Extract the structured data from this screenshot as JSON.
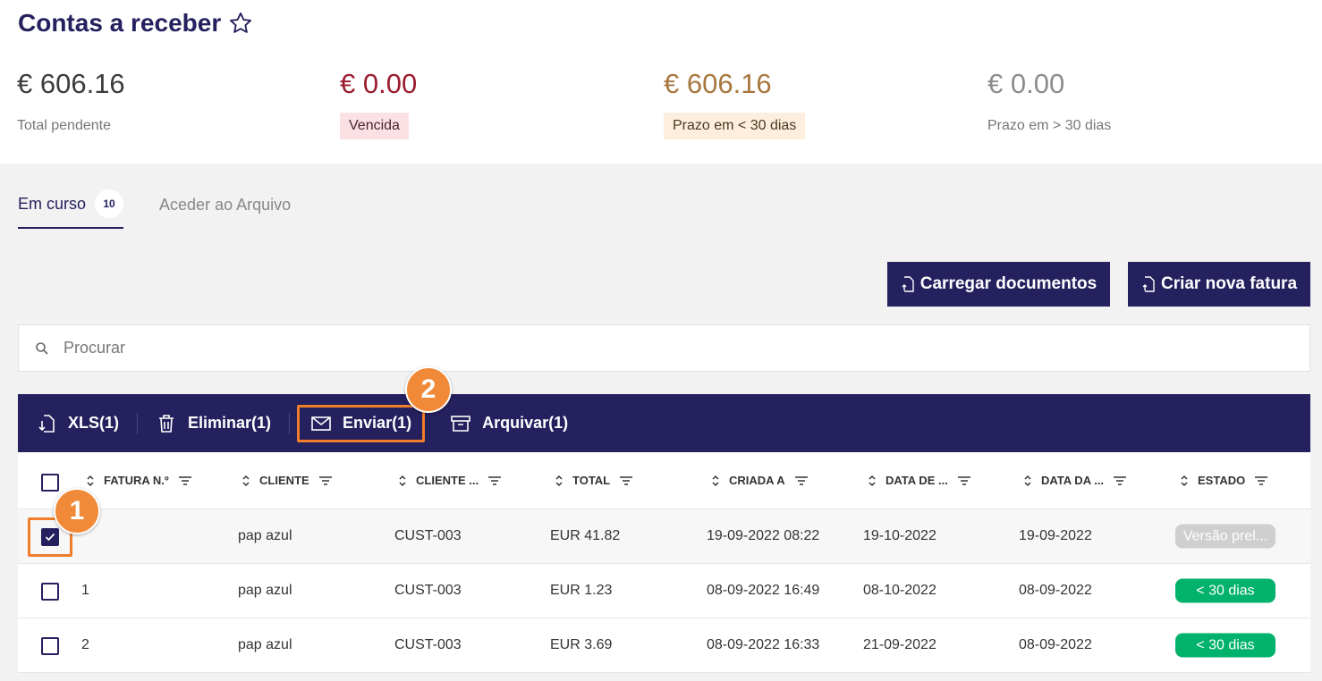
{
  "header": {
    "title": "Contas a receber"
  },
  "kpis": [
    {
      "amount": "€ 606.16",
      "label": "Total pendente"
    },
    {
      "amount": "€ 0.00",
      "label": "Vencida"
    },
    {
      "amount": "€ 606.16",
      "label": "Prazo em < 30 dias"
    },
    {
      "amount": "€ 0.00",
      "label": "Prazo em > 30 dias"
    }
  ],
  "tabs": [
    {
      "label": "Em curso",
      "count": "10"
    },
    {
      "label": "Aceder ao Arquivo"
    }
  ],
  "buttons": {
    "upload": "Carregar documentos",
    "create": "Criar nova fatura"
  },
  "search": {
    "placeholder": "Procurar",
    "value": ""
  },
  "actions": [
    "XLS(1)",
    "Eliminar(1)",
    "Enviar(1)",
    "Arquivar(1)"
  ],
  "callouts": [
    "1",
    "2"
  ],
  "table": {
    "columns": [
      "FATURA N.º",
      "CLIENTE",
      "CLIENTE ...",
      "TOTAL",
      "CRIADA A",
      "DATA DE ...",
      "DATA DA ...",
      "ESTADO"
    ],
    "rows": [
      {
        "checked": true,
        "invoice": "",
        "client": "pap azul",
        "client_id": "CUST-003",
        "total": "EUR 41.82",
        "created": "19-09-2022 08:22",
        "due": "19-10-2022",
        "date": "19-09-2022",
        "status": "Versão prel...",
        "status_type": "draft"
      },
      {
        "checked": false,
        "invoice": "1",
        "client": "pap azul",
        "client_id": "CUST-003",
        "total": "EUR 1.23",
        "created": "08-09-2022 16:49",
        "due": "08-10-2022",
        "date": "08-09-2022",
        "status": "< 30 dias",
        "status_type": "ok"
      },
      {
        "checked": false,
        "invoice": "2",
        "client": "pap azul",
        "client_id": "CUST-003",
        "total": "EUR 3.69",
        "created": "08-09-2022 16:33",
        "due": "21-09-2022",
        "date": "08-09-2022",
        "status": "< 30 dias",
        "status_type": "ok"
      }
    ]
  },
  "colors": {
    "primary": "#25205e",
    "highlight": "#f07e2a",
    "ok": "#00b26b",
    "draft": "#cfcfcf"
  }
}
